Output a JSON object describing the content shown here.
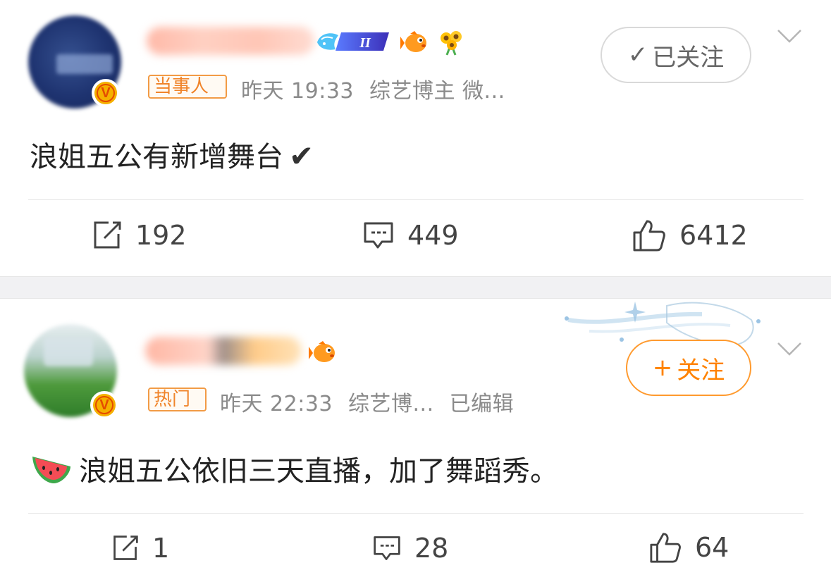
{
  "posts": [
    {
      "tag": "当事人",
      "time": "昨天 19:33",
      "category": "综艺博主 微...",
      "edited": "",
      "follow": {
        "icon": "✓",
        "label": "已关注",
        "state": "following"
      },
      "content": "浪姐五公有新增舞台",
      "content_emoji": "✔",
      "actions": {
        "reposts": "192",
        "comments": "449",
        "likes": "6412"
      },
      "level_badge": "II"
    },
    {
      "tag": "热门",
      "time": "昨天 22:33",
      "category": "综艺博...",
      "edited": "已编辑",
      "follow": {
        "icon": "+",
        "label": "关注",
        "state": "not-following"
      },
      "content": "浪姐五公依旧三天直播，加了舞蹈秀。",
      "actions": {
        "reposts": "1",
        "comments": "28",
        "likes": "64"
      }
    }
  ],
  "verified_badge": "V",
  "colors": {
    "accent_orange": "#ff8200",
    "tag_border": "#f29b45",
    "verified_gold": "#f5b000",
    "separator": "#f1f1f3",
    "muted_text": "#8a8a8a"
  },
  "icons": [
    "repost-icon",
    "comment-icon",
    "like-icon",
    "chevron-down-icon",
    "fish-emoji-icon",
    "sunflower-emoji-icon",
    "watermelon-emoji-icon",
    "level-badge-icon"
  ]
}
